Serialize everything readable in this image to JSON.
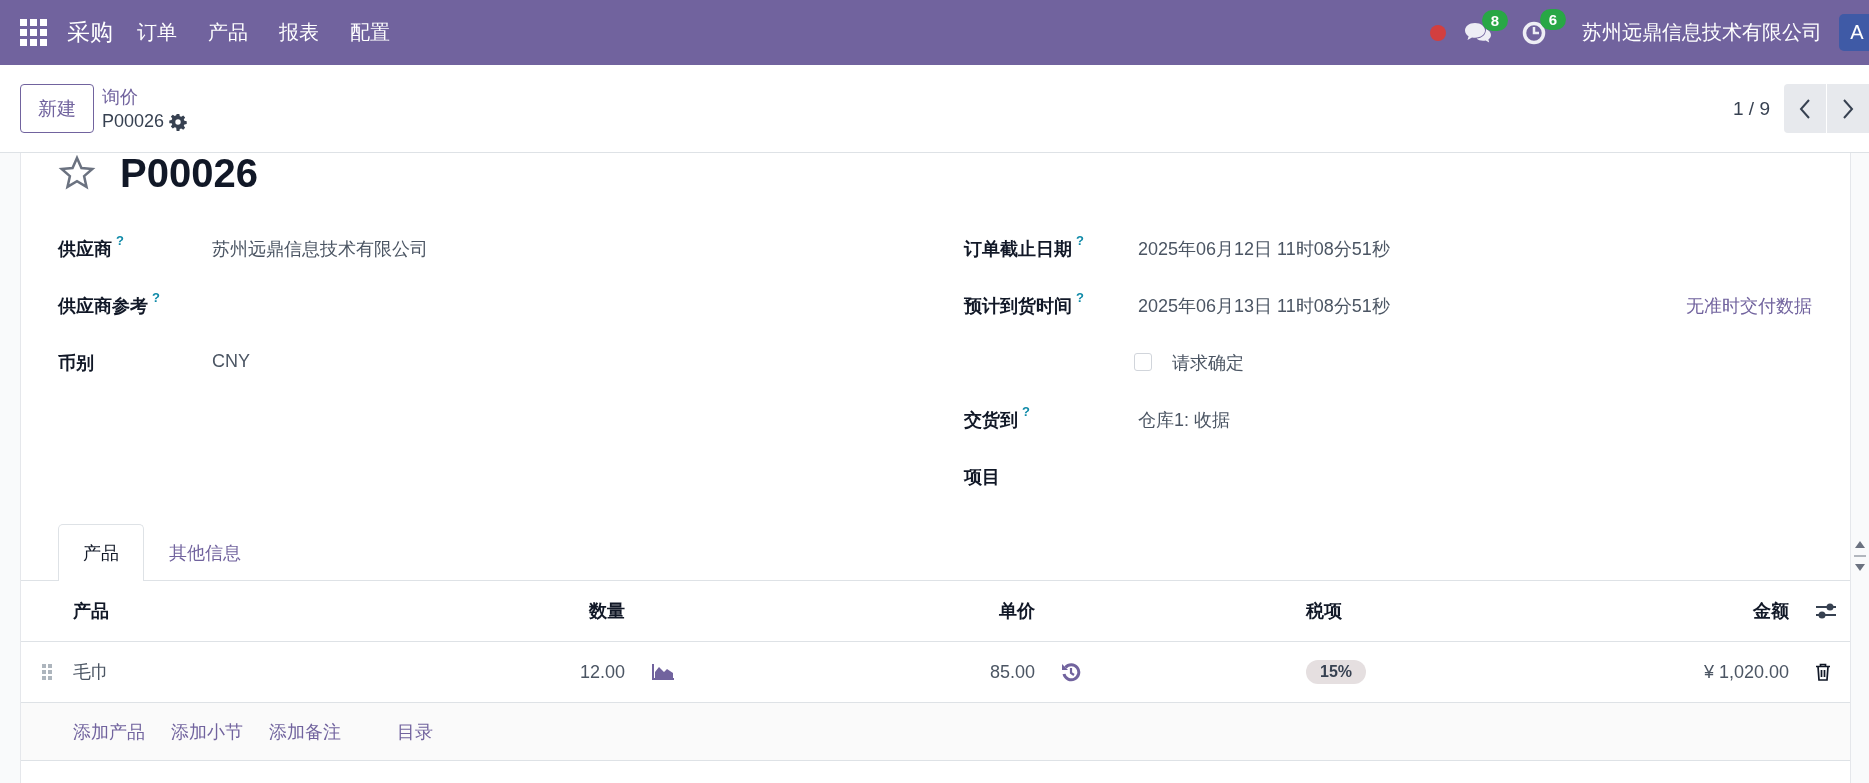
{
  "navbar": {
    "app_name": "采购",
    "menu": [
      "订单",
      "产品",
      "报表",
      "配置"
    ],
    "messages_badge": "8",
    "activities_badge": "6",
    "company": "苏州远鼎信息技术有限公司",
    "avatar_letter": "A"
  },
  "control_panel": {
    "new_button": "新建",
    "breadcrumb": "询价",
    "record": "P00026",
    "pager": "1 / 9"
  },
  "form": {
    "title": "P00026",
    "starred": false,
    "left_fields": [
      {
        "kind": "field",
        "label": "供应商",
        "help": "?",
        "value": "苏州远鼎信息技术有限公司"
      },
      {
        "kind": "field",
        "label": "供应商参考",
        "help": "?"
      },
      {
        "kind": "field",
        "label": "币别",
        "value": "CNY"
      }
    ],
    "right_fields": [
      {
        "kind": "field",
        "label": "订单截止日期",
        "help": "?",
        "value": "2025年06月12日 11时08分51秒"
      },
      {
        "kind": "field",
        "label": "预计到货时间",
        "help": "?",
        "value": "2025年06月13日 11时08分51秒",
        "link": "无准时交付数据"
      },
      {
        "kind": "checkbox",
        "label": "请求确定",
        "checked": false
      },
      {
        "kind": "field",
        "label": "交货到",
        "help": "?",
        "value": "仓库1: 收据"
      },
      {
        "kind": "field",
        "label": "项目"
      }
    ]
  },
  "tabs": [
    {
      "label": "产品",
      "selected": true
    },
    {
      "label": "其他信息",
      "selected": false
    }
  ],
  "table": {
    "columns": [
      "产品",
      "数量",
      "单价",
      "税项",
      "金额"
    ],
    "rows": [
      {
        "product": "毛巾",
        "quantity": "12.00",
        "unit_price": "85.00",
        "taxes": [
          "15%"
        ],
        "amount": "¥ 1,020.00"
      }
    ],
    "add_links": [
      "添加产品",
      "添加小节",
      "添加备注"
    ],
    "catalog_link": "目录"
  }
}
